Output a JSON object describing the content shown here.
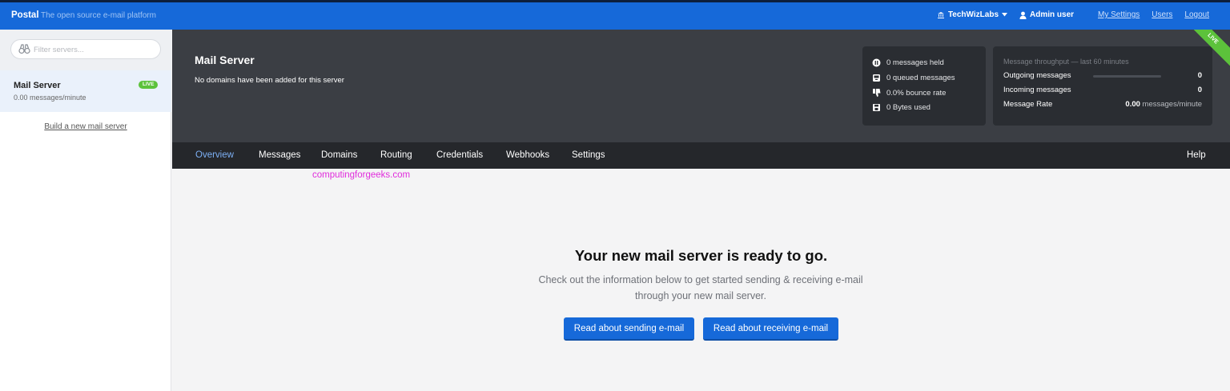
{
  "topbar": {
    "brand": "Postal",
    "tagline": "The open source e-mail platform",
    "org": "TechWizLabs",
    "user": "Admin user",
    "links": [
      "My Settings",
      "Users",
      "Logout"
    ]
  },
  "sidebar": {
    "filter_placeholder": "Filter servers...",
    "server": {
      "name": "Mail Server",
      "rate": "0.00 messages/minute",
      "badge": "LIVE"
    },
    "build_link": "Build a new mail server"
  },
  "header": {
    "title": "Mail Server",
    "subtitle": "No domains have been added for this server",
    "stats": [
      "0 messages held",
      "0 queued messages",
      "0.0% bounce rate",
      "0 Bytes used"
    ],
    "throughput": {
      "title": "Message throughput — last 60 minutes",
      "outgoing_label": "Outgoing messages",
      "outgoing_value": "0",
      "incoming_label": "Incoming messages",
      "incoming_value": "0",
      "rate_label": "Message Rate",
      "rate_value": "0.00",
      "rate_unit": "messages/minute"
    },
    "ribbon": "LIVE"
  },
  "tabs": [
    "Overview",
    "Messages",
    "Domains",
    "Routing",
    "Credentials",
    "Webhooks",
    "Settings"
  ],
  "help": "Help",
  "watermark": "computingforgeeks.com",
  "main": {
    "title": "Your new mail server is ready to go.",
    "text": "Check out the information below to get started sending & receiving e-mail through your new mail server.",
    "btn_send": "Read about sending e-mail",
    "btn_receive": "Read about receiving e-mail"
  }
}
